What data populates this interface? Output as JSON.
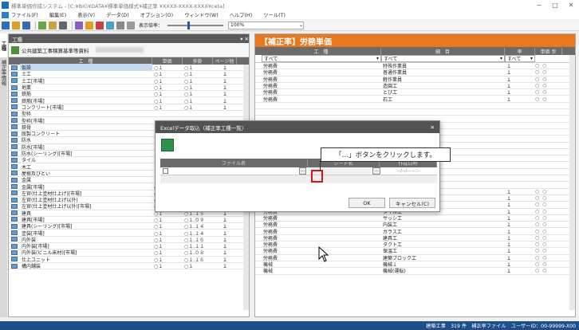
{
  "window": {
    "title": "標準単価作成システム - [C:¥BIG¥DATA¥標準単価様式¥補正率 ¥XXXX-XXXX-XXXX¥ceta]",
    "min": "−",
    "max": "□",
    "close": "✕"
  },
  "menu": [
    "ファイル(F)",
    "編集(E)",
    "表示(V)",
    "データ(D)",
    "オプション(O)",
    "ウィンドウ(W)",
    "ヘルプ(H)",
    "ツール(T)"
  ],
  "toolbar": {
    "zoom_label": "表示倍率：",
    "zoom_value": "100%",
    "zoom_fraction": 0.36
  },
  "left_tabs": [
    "工種",
    "補正率情報"
  ],
  "left_pane": {
    "header": "工種",
    "subtitle": "公共建築工事積算基準等資料",
    "columns": [
      "工　種",
      "単価",
      "歩掛",
      "ページ他"
    ],
    "rows": [
      {
        "name": "仮設",
        "v1": "○１",
        "v2": "○１",
        "v3": "１"
      },
      {
        "name": "土工",
        "v1": "○１",
        "v2": "○１",
        "v3": "１"
      },
      {
        "name": "土工[市場]",
        "v1": "○１",
        "v2": "○１",
        "v3": "１"
      },
      {
        "name": "地業",
        "v1": "○１",
        "v2": "○１",
        "v3": "１"
      },
      {
        "name": "鉄筋",
        "v1": "○１",
        "v2": "○１",
        "v3": "１"
      },
      {
        "name": "鉄筋[市場]",
        "v1": "○１",
        "v2": "○１",
        "v3": "１"
      },
      {
        "name": "コンクリート[市場]",
        "v1": "○１",
        "v2": "○１",
        "v3": "１"
      },
      {
        "name": "型枠",
        "v1": "",
        "v2": "",
        "v3": ""
      },
      {
        "name": "型枠[市場]",
        "v1": "",
        "v2": "",
        "v3": ""
      },
      {
        "name": "鉄骨",
        "v1": "",
        "v2": "",
        "v3": ""
      },
      {
        "name": "既製コンクリート",
        "v1": "",
        "v2": "",
        "v3": ""
      },
      {
        "name": "防水",
        "v1": "",
        "v2": "",
        "v3": ""
      },
      {
        "name": "防水[市場]",
        "v1": "",
        "v2": "",
        "v3": ""
      },
      {
        "name": "防水(シーリング)[市場]",
        "v1": "",
        "v2": "",
        "v3": ""
      },
      {
        "name": "タイル",
        "v1": "",
        "v2": "",
        "v3": ""
      },
      {
        "name": "木工",
        "v1": "",
        "v2": "",
        "v3": ""
      },
      {
        "name": "屋根及びとい",
        "v1": "",
        "v2": "",
        "v3": ""
      },
      {
        "name": "金属",
        "v1": "",
        "v2": "",
        "v3": ""
      },
      {
        "name": "金属[市場]",
        "v1": "○１",
        "v2": "○１.０８",
        "v3": "１"
      },
      {
        "name": "左官(仕上塗材仕上げ)[市場]",
        "v1": "○１",
        "v2": "○１",
        "v3": "１"
      },
      {
        "name": "左官(仕上塗材仕上げ以外)",
        "v1": "○１",
        "v2": "○１.１５",
        "v3": "１"
      },
      {
        "name": "左官(仕上塗材仕上げ以外)[市場]",
        "v1": "○１",
        "v2": "○１.１４",
        "v3": "１"
      },
      {
        "name": "建具",
        "v1": "○１",
        "v2": "○１.１５",
        "v3": "１"
      },
      {
        "name": "建具[市場]",
        "v1": "○１",
        "v2": "○１.０９",
        "v3": "１"
      },
      {
        "name": "建具(シーリング)[市場]",
        "v1": "○１",
        "v2": "○１.１４",
        "v3": "１"
      },
      {
        "name": "塗装[市場]",
        "v1": "○１",
        "v2": "○１.１４",
        "v3": "１"
      },
      {
        "name": "内外装",
        "v1": "○１",
        "v2": "○１.１６",
        "v3": "１"
      },
      {
        "name": "内外装[市場]",
        "v1": "○１",
        "v2": "○１.１１",
        "v3": "１"
      },
      {
        "name": "内外装(ビニル床材)[市場]",
        "v1": "○１",
        "v2": "○１.０８",
        "v3": "１"
      },
      {
        "name": "仕上ユニット",
        "v1": "○１",
        "v2": "○１.１６",
        "v3": "１"
      },
      {
        "name": "構内舗装",
        "v1": "○１",
        "v2": "○１",
        "v3": "１"
      }
    ]
  },
  "right_pane": {
    "title": "【補正率】労務単価",
    "columns": [
      "工　種",
      "細　目",
      "率",
      "単価",
      "歩"
    ],
    "filters": {
      "f1": "すべて",
      "f2": "すべて",
      "f3": "すべて"
    },
    "rows": [
      {
        "kind": "労務費",
        "item": "特殊作業員",
        "rate": "１",
        "marks": "○ ○"
      },
      {
        "kind": "労務費",
        "item": "普通作業員",
        "rate": "１",
        "marks": "○ ○"
      },
      {
        "kind": "労務費",
        "item": "軽作業員",
        "rate": "１",
        "marks": "○ ○"
      },
      {
        "kind": "労務費",
        "item": "造園工",
        "rate": "１",
        "marks": "○ ○"
      },
      {
        "kind": "労務費",
        "item": "とび工",
        "rate": "１",
        "marks": "○ ○"
      },
      {
        "kind": "労務費",
        "item": "石工",
        "rate": "１",
        "marks": "○ ○"
      },
      {
        "kind": "",
        "item": "",
        "rate": "",
        "marks": ""
      },
      {
        "kind": "",
        "item": "",
        "rate": "",
        "marks": ""
      },
      {
        "kind": "",
        "item": "",
        "rate": "",
        "marks": ""
      },
      {
        "kind": "",
        "item": "",
        "rate": "",
        "marks": ""
      },
      {
        "kind": "",
        "item": "",
        "rate": "",
        "marks": ""
      },
      {
        "kind": "",
        "item": "",
        "rate": "",
        "marks": ""
      },
      {
        "kind": "",
        "item": "",
        "rate": "",
        "marks": ""
      },
      {
        "kind": "",
        "item": "",
        "rate": "",
        "marks": ""
      },
      {
        "kind": "",
        "item": "",
        "rate": "",
        "marks": ""
      },
      {
        "kind": "",
        "item": "",
        "rate": "",
        "marks": ""
      },
      {
        "kind": "",
        "item": "",
        "rate": "",
        "marks": ""
      },
      {
        "kind": "",
        "item": "",
        "rate": "",
        "marks": ""
      },
      {
        "kind": "",
        "item": "",
        "rate": "",
        "marks": ""
      },
      {
        "kind": "労務費",
        "item": "はつり工",
        "rate": "１",
        "marks": "○ ○"
      },
      {
        "kind": "労務費",
        "item": "防水工",
        "rate": "１",
        "marks": "○ ○"
      },
      {
        "kind": "労務費",
        "item": "板金工",
        "rate": "１",
        "marks": "○ ○"
      },
      {
        "kind": "労務費",
        "item": "タイル工",
        "rate": "１",
        "marks": "○ ○"
      },
      {
        "kind": "労務費",
        "item": "サッシ工",
        "rate": "１",
        "marks": "○ ○"
      },
      {
        "kind": "労務費",
        "item": "内装工",
        "rate": "１",
        "marks": "○ ○"
      },
      {
        "kind": "労務費",
        "item": "ガラス工",
        "rate": "１",
        "marks": "○ ○"
      },
      {
        "kind": "労務費",
        "item": "建具工",
        "rate": "１",
        "marks": "○ ○"
      },
      {
        "kind": "労務費",
        "item": "ダクト工",
        "rate": "１",
        "marks": "○ ○"
      },
      {
        "kind": "労務費",
        "item": "保温工",
        "rate": "１",
        "marks": "○ ○"
      },
      {
        "kind": "労務費",
        "item": "建築ブロック工",
        "rate": "１",
        "marks": "○ ○"
      },
      {
        "kind": "機械",
        "item": "機械１",
        "rate": "１",
        "marks": "○ ○"
      },
      {
        "kind": "機械",
        "item": "機械(運転)",
        "rate": "１",
        "marks": "○ ○"
      }
    ]
  },
  "dialog": {
    "title": "Excelデータ取込（補正率工種一覧）",
    "col_file": "ファイル名",
    "col_sheet": "シート名",
    "col_date": "作成日時",
    "file_value": "",
    "ellipsis": "…",
    "date_value": "--/--/-- --:--",
    "ok": "OK",
    "cancel": "キャンセル(C)"
  },
  "callout": "「…」ボタンをクリックします。",
  "status": "建築工事　319 件　補正率ファイル　ユーザーID：00-99999-X00"
}
